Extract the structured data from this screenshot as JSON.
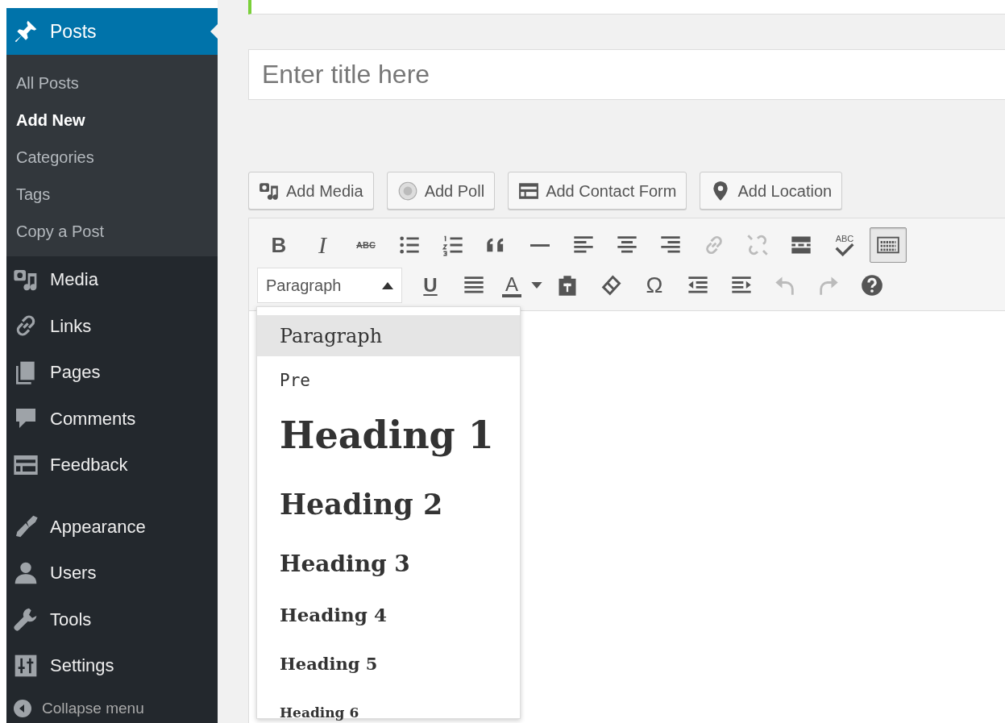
{
  "sidebar": {
    "menu": [
      {
        "label": "Posts",
        "current": true,
        "separator_before": false,
        "submenu": [
          {
            "label": "All Posts",
            "selected": false
          },
          {
            "label": "Add New",
            "selected": true
          },
          {
            "label": "Categories",
            "selected": false
          },
          {
            "label": "Tags",
            "selected": false
          },
          {
            "label": "Copy a Post",
            "selected": false
          }
        ]
      },
      {
        "label": "Media",
        "current": false,
        "separator_before": false
      },
      {
        "label": "Links",
        "current": false,
        "separator_before": false
      },
      {
        "label": "Pages",
        "current": false,
        "separator_before": false
      },
      {
        "label": "Comments",
        "current": false,
        "separator_before": false
      },
      {
        "label": "Feedback",
        "current": false,
        "separator_before": false
      },
      {
        "label": "Appearance",
        "current": false,
        "separator_before": true
      },
      {
        "label": "Users",
        "current": false,
        "separator_before": false
      },
      {
        "label": "Tools",
        "current": false,
        "separator_before": false
      },
      {
        "label": "Settings",
        "current": false,
        "separator_before": false
      }
    ],
    "collapse": {
      "label": "Collapse menu"
    }
  },
  "editor": {
    "title": {
      "placeholder": "Enter title here"
    },
    "media_buttons": [
      {
        "label": "Add Media",
        "kind": "media"
      },
      {
        "label": "Add Poll",
        "kind": "poll"
      },
      {
        "label": "Add Contact Form",
        "kind": "form"
      },
      {
        "label": "Add Location",
        "kind": "location"
      }
    ],
    "toolbar": {
      "rows": [
        [
          {
            "kind": "bold",
            "text": "B",
            "disabled": false,
            "pressed": false
          },
          {
            "kind": "italic",
            "text": "I",
            "disabled": false,
            "pressed": false
          },
          {
            "kind": "strike",
            "text": "ABC",
            "disabled": false,
            "pressed": false
          },
          {
            "kind": "bullets",
            "disabled": false,
            "pressed": false
          },
          {
            "kind": "numbers",
            "disabled": false,
            "pressed": false
          },
          {
            "kind": "quote",
            "disabled": false,
            "pressed": false
          },
          {
            "kind": "hr",
            "disabled": false,
            "pressed": false
          },
          {
            "kind": "align-left",
            "disabled": false,
            "pressed": false
          },
          {
            "kind": "align-center",
            "disabled": false,
            "pressed": false
          },
          {
            "kind": "align-right",
            "disabled": false,
            "pressed": false
          },
          {
            "kind": "link",
            "disabled": true,
            "pressed": false
          },
          {
            "kind": "unlink",
            "disabled": true,
            "pressed": false
          },
          {
            "kind": "more",
            "disabled": false,
            "pressed": false
          },
          {
            "kind": "spellcheck",
            "text": "ABC",
            "disabled": false,
            "pressed": false
          },
          {
            "kind": "keyboard",
            "disabled": false,
            "pressed": true
          }
        ],
        [
          {
            "kind": "underline",
            "text": "U",
            "disabled": false,
            "pressed": false
          },
          {
            "kind": "justify",
            "disabled": false,
            "pressed": false
          },
          {
            "kind": "textcolor",
            "text": "A",
            "disabled": false,
            "pressed": false
          },
          {
            "kind": "caret",
            "disabled": false,
            "pressed": false
          },
          {
            "kind": "paste",
            "disabled": false,
            "pressed": false
          },
          {
            "kind": "eraser",
            "disabled": false,
            "pressed": false
          },
          {
            "kind": "omega",
            "text": "Ω",
            "disabled": false,
            "pressed": false
          },
          {
            "kind": "outdent",
            "disabled": false,
            "pressed": false
          },
          {
            "kind": "indent",
            "disabled": false,
            "pressed": false
          },
          {
            "kind": "undo",
            "disabled": true,
            "pressed": false
          },
          {
            "kind": "redo",
            "disabled": true,
            "pressed": false
          },
          {
            "kind": "help",
            "disabled": false,
            "pressed": false
          }
        ]
      ]
    },
    "format_select": {
      "value": "Paragraph",
      "expanded": true
    },
    "format_menu": [
      {
        "label": "Paragraph",
        "kind": "p",
        "selected": true
      },
      {
        "label": "Pre",
        "kind": "pre",
        "selected": false
      },
      {
        "label": "Heading 1",
        "kind": "h1",
        "selected": false
      },
      {
        "label": "Heading 2",
        "kind": "h2",
        "selected": false
      },
      {
        "label": "Heading 3",
        "kind": "h3",
        "selected": false
      },
      {
        "label": "Heading 4",
        "kind": "h4",
        "selected": false
      },
      {
        "label": "Heading 5",
        "kind": "h5",
        "selected": false
      },
      {
        "label": "Heading 6",
        "kind": "h6",
        "selected": false
      }
    ]
  }
}
